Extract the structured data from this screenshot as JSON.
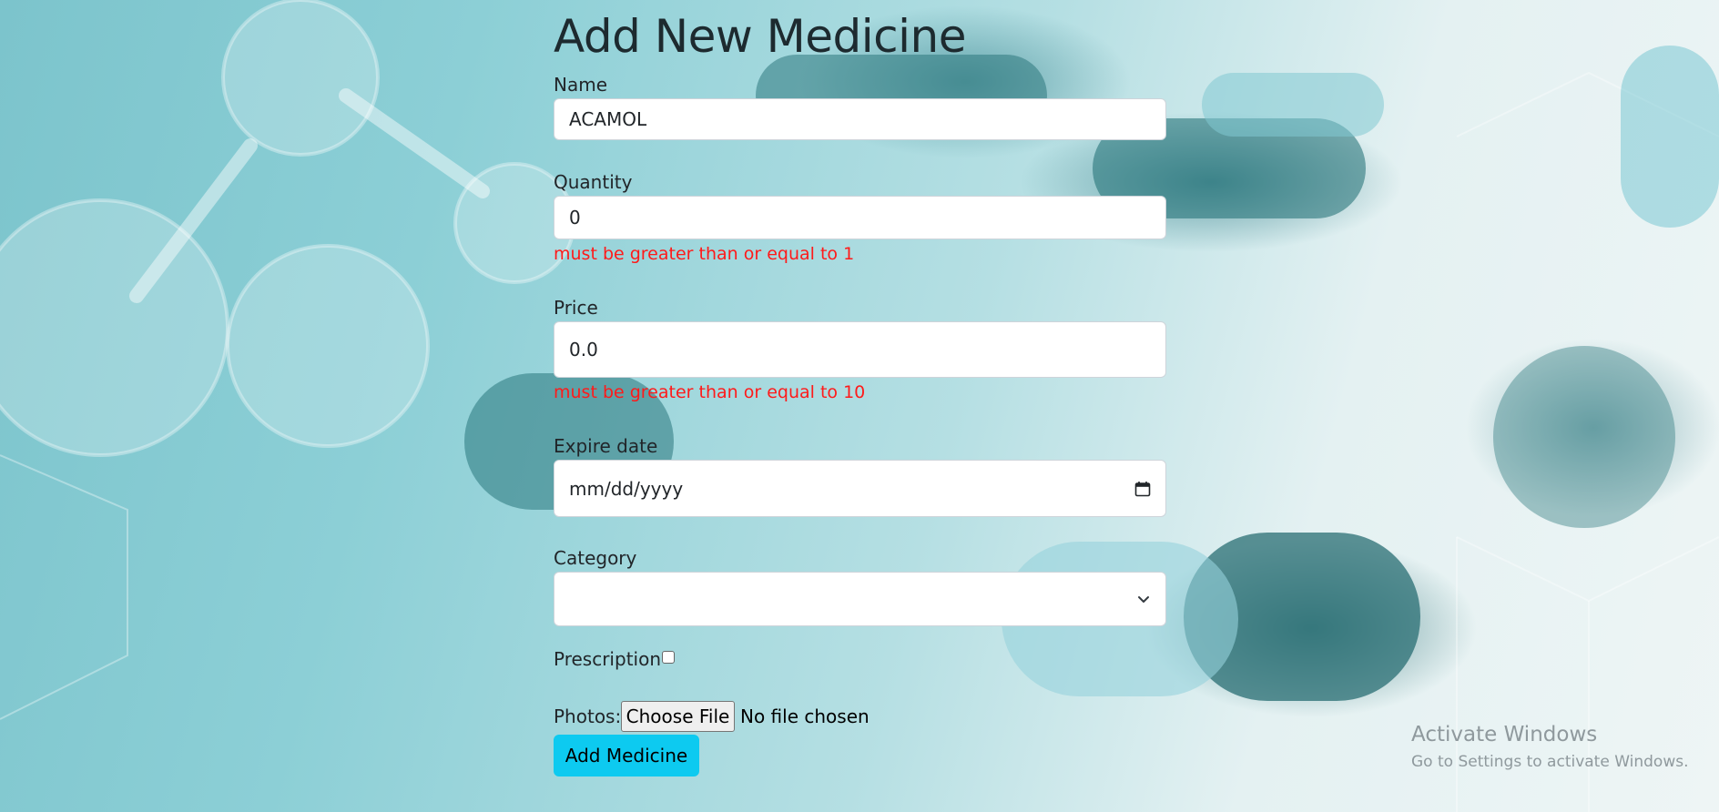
{
  "page": {
    "title": "Add New Medicine"
  },
  "form": {
    "name": {
      "label": "Name",
      "value": "ACAMOL"
    },
    "quantity": {
      "label": "Quantity",
      "value": "0",
      "error": "must be greater than or equal to 1"
    },
    "price": {
      "label": "Price",
      "value": "0.0",
      "error": "must be greater than or equal to 10"
    },
    "expire_date": {
      "label": "Expire date",
      "placeholder": "mm/dd/yyyy",
      "icon": "calendar-icon"
    },
    "category": {
      "label": "Category",
      "selected": "",
      "icon": "chevron-down-icon"
    },
    "prescription": {
      "label": "Prescription",
      "checked": false
    },
    "photos": {
      "label": "Photos:",
      "button_label": "Choose File",
      "status": "No file chosen"
    },
    "submit_label": "Add Medicine"
  },
  "windows_watermark": {
    "title": "Activate Windows",
    "subtitle": "Go to Settings to activate Windows."
  },
  "colors": {
    "error": "#ff1a1a",
    "submit_button": "#0dcaf0",
    "background": "#8ccfd6"
  }
}
